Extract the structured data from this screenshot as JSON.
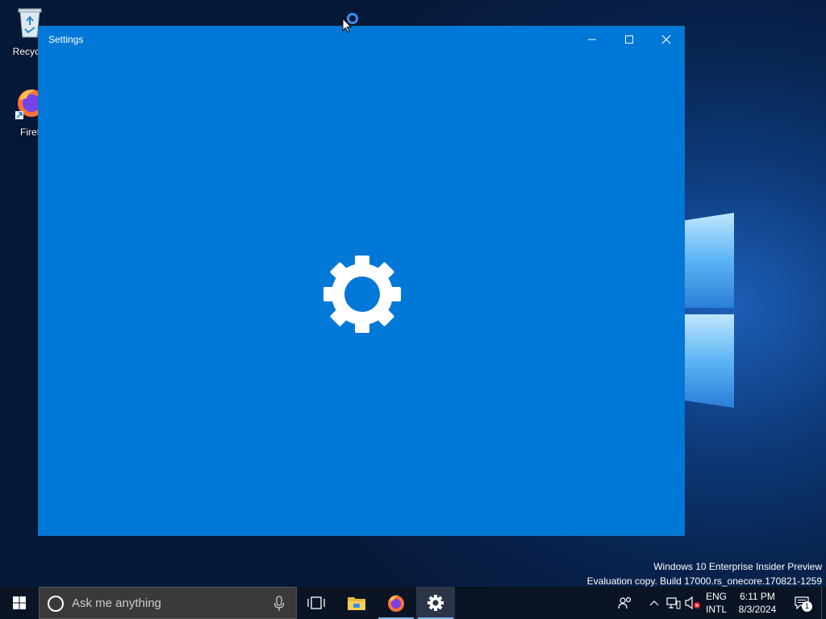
{
  "desktop": {
    "icons": [
      {
        "label": "Recycle",
        "icon": "recycle-bin-icon"
      },
      {
        "label": "Firef",
        "icon": "firefox-icon"
      }
    ],
    "watermark": {
      "line1": "Windows 10 Enterprise Insider Preview",
      "line2": "Evaluation copy. Build 17000.rs_onecore.170821-1259"
    }
  },
  "window": {
    "title": "Settings",
    "accent": "#0078d7",
    "splash_icon": "gear-icon"
  },
  "taskbar": {
    "search_placeholder": "Ask me anything",
    "apps": [
      "task-view-icon",
      "file-explorer-icon",
      "firefox-icon",
      "settings-icon"
    ],
    "language": {
      "line1": "ENG",
      "line2": "INTL"
    },
    "clock": {
      "time": "6:11 PM",
      "date": "8/3/2024"
    },
    "notification_count": "1"
  }
}
